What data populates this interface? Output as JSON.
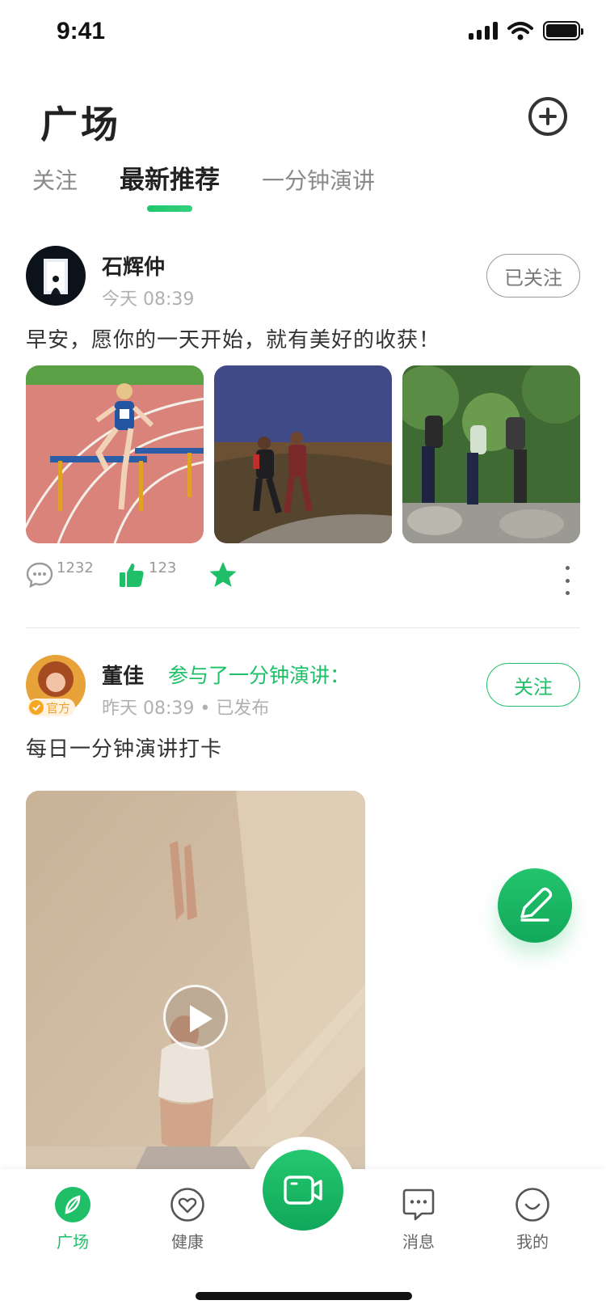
{
  "status_bar": {
    "time": "9:41"
  },
  "header": {
    "title": "广场"
  },
  "tabs": [
    {
      "label": "关注",
      "active": false
    },
    {
      "label": "最新推荐",
      "active": true
    },
    {
      "label": "一分钟演讲",
      "active": false
    }
  ],
  "posts": [
    {
      "author": "石辉仲",
      "time": "今天 08:39",
      "follow_label": "已关注",
      "text": "早安，愿你的一天开始，就有美好的收获！",
      "comments": "1232",
      "likes": "123",
      "images": [
        "hurdle-runner",
        "two-runners-sunset",
        "hikers-forest"
      ]
    },
    {
      "author": "董佳",
      "badge": "官方",
      "participation": "参与了一分钟演讲：",
      "time": "昨天 08:39 • 已发布",
      "follow_label": "关注",
      "text": "每日一分钟演讲打卡",
      "video": "yoga-pose"
    }
  ],
  "bottom_nav": [
    {
      "label": "广场",
      "icon": "compass-icon",
      "active": true
    },
    {
      "label": "健康",
      "icon": "heart-icon",
      "active": false
    },
    {
      "label": "消息",
      "icon": "chat-icon",
      "active": false
    },
    {
      "label": "我的",
      "icon": "smile-icon",
      "active": false
    }
  ],
  "colors": {
    "accent": "#1fbf68",
    "badge": "#f5a623",
    "text_primary": "#222222",
    "text_muted": "#b0b0b0"
  }
}
